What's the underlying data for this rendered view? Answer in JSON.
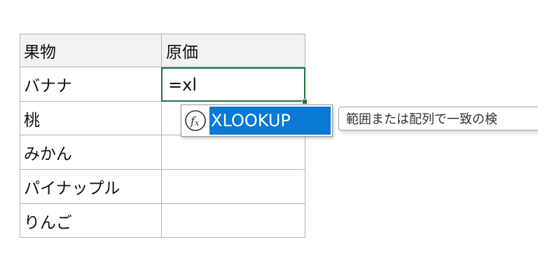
{
  "sheet": {
    "headers": [
      "果物",
      "原価"
    ],
    "rows": [
      {
        "fruit": "バナナ",
        "cost": ""
      },
      {
        "fruit": "桃",
        "cost": ""
      },
      {
        "fruit": "みかん",
        "cost": ""
      },
      {
        "fruit": "パイナップル",
        "cost": ""
      },
      {
        "fruit": "りんご",
        "cost": ""
      }
    ],
    "active_cell_value": "=xl"
  },
  "autocomplete": {
    "icon": "function-fx-icon",
    "items": [
      "XLOOKUP"
    ],
    "tooltip": "範囲または配列で一致の検"
  },
  "colors": {
    "header_bg": "#f2f2f2",
    "gridline": "#b3b3b3",
    "active_border": "#217346",
    "selection_bg": "#0a78d4"
  }
}
